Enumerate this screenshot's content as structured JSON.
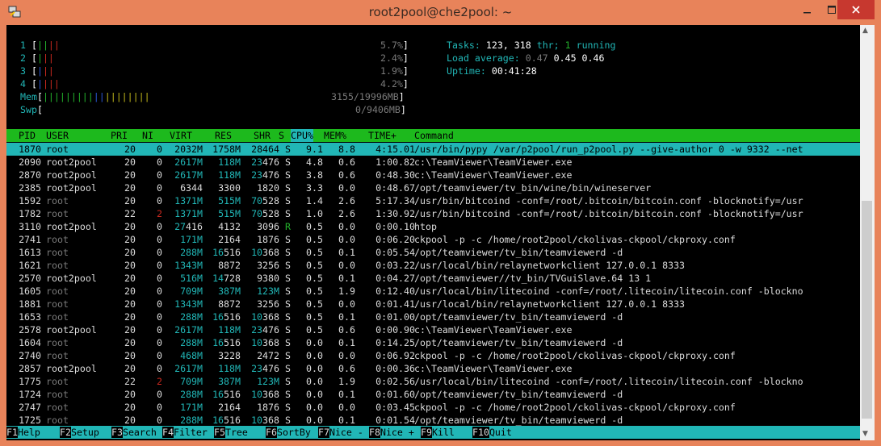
{
  "window": {
    "title": "root2pool@che2pool: ~"
  },
  "meters": {
    "cpus": [
      {
        "label": "1",
        "percent": "5.7%"
      },
      {
        "label": "2",
        "percent": "2.4%"
      },
      {
        "label": "3",
        "percent": "1.9%"
      },
      {
        "label": "4",
        "percent": "4.2%"
      }
    ],
    "mem": {
      "label": "Mem",
      "value": "3155/19996MB"
    },
    "swp": {
      "label": "Swp",
      "value": "0/9406MB"
    }
  },
  "summary": {
    "tasks_label": "Tasks:",
    "tasks": "123,",
    "thr": "318",
    "thr_label": "thr;",
    "running": "1",
    "running_label": "running",
    "load_label": "Load average:",
    "load1": "0.47",
    "load5": "0.45",
    "load15": "0.46",
    "uptime_label": "Uptime:",
    "uptime": "00:41:28"
  },
  "columns": [
    "PID",
    "USER",
    "PRI",
    "NI",
    "VIRT",
    "RES",
    "SHR",
    "S",
    "CPU%",
    "MEM%",
    "TIME+",
    "Command"
  ],
  "processes": [
    {
      "pid": "1870",
      "user": "root",
      "pri": "20",
      "ni": "0",
      "virt": "2032M",
      "res": "1758M",
      "shr": "28464",
      "s": "S",
      "cpu": "9.1",
      "mem": "8.8",
      "time": "4:15.01",
      "cmd": "/usr/bin/pypy /var/p2pool/run_p2pool.py --give-author 0 -w 9332 --net"
    },
    {
      "pid": "2090",
      "user": "root2pool",
      "pri": "20",
      "ni": "0",
      "virt": "2617M",
      "res": "118M",
      "shr": "23476",
      "s": "S",
      "cpu": "4.8",
      "mem": "0.6",
      "time": "1:00.82",
      "cmd": "c:\\TeamViewer\\TeamViewer.exe"
    },
    {
      "pid": "2870",
      "user": "root2pool",
      "pri": "20",
      "ni": "0",
      "virt": "2617M",
      "res": "118M",
      "shr": "23476",
      "s": "S",
      "cpu": "3.8",
      "mem": "0.6",
      "time": "0:48.30",
      "cmd": "c:\\TeamViewer\\TeamViewer.exe"
    },
    {
      "pid": "2385",
      "user": "root2pool",
      "pri": "20",
      "ni": "0",
      "virt": "6344",
      "res": "3300",
      "shr": "1820",
      "s": "S",
      "cpu": "3.3",
      "mem": "0.0",
      "time": "0:48.67",
      "cmd": "/opt/teamviewer/tv_bin/wine/bin/wineserver"
    },
    {
      "pid": "1592",
      "user": "root",
      "pri": "20",
      "ni": "0",
      "virt": "1371M",
      "res": "515M",
      "shr": "70528",
      "s": "S",
      "cpu": "1.4",
      "mem": "2.6",
      "time": "5:17.34",
      "cmd": "/usr/bin/bitcoind -conf=/root/.bitcoin/bitcoin.conf -blocknotify=/usr"
    },
    {
      "pid": "1782",
      "user": "root",
      "pri": "22",
      "ni": "2",
      "virt": "1371M",
      "res": "515M",
      "shr": "70528",
      "s": "S",
      "cpu": "1.0",
      "mem": "2.6",
      "time": "1:30.92",
      "cmd": "/usr/bin/bitcoind -conf=/root/.bitcoin/bitcoin.conf -blocknotify=/usr"
    },
    {
      "pid": "3110",
      "user": "root2pool",
      "pri": "20",
      "ni": "0",
      "virt": "27416",
      "res": "4132",
      "shr": "3096",
      "s": "R",
      "cpu": "0.5",
      "mem": "0.0",
      "time": "0:00.10",
      "cmd": "htop"
    },
    {
      "pid": "2741",
      "user": "root",
      "pri": "20",
      "ni": "0",
      "virt": "171M",
      "res": "2164",
      "shr": "1876",
      "s": "S",
      "cpu": "0.5",
      "mem": "0.0",
      "time": "0:06.20",
      "cmd": "ckpool -p -c /home/root2pool/ckolivas-ckpool/ckproxy.conf"
    },
    {
      "pid": "1613",
      "user": "root",
      "pri": "20",
      "ni": "0",
      "virt": "288M",
      "res": "16516",
      "shr": "10368",
      "s": "S",
      "cpu": "0.5",
      "mem": "0.1",
      "time": "0:05.54",
      "cmd": "/opt/teamviewer/tv_bin/teamviewerd -d"
    },
    {
      "pid": "1621",
      "user": "root",
      "pri": "20",
      "ni": "0",
      "virt": "1343M",
      "res": "8872",
      "shr": "3256",
      "s": "S",
      "cpu": "0.5",
      "mem": "0.0",
      "time": "0:03.22",
      "cmd": "/usr/local/bin/relaynetworkclient 127.0.0.1 8333"
    },
    {
      "pid": "2570",
      "user": "root2pool",
      "pri": "20",
      "ni": "0",
      "virt": "516M",
      "res": "14728",
      "shr": "9380",
      "s": "S",
      "cpu": "0.5",
      "mem": "0.1",
      "time": "0:04.27",
      "cmd": "/opt/teamviewer//tv_bin/TVGuiSlave.64 13 1"
    },
    {
      "pid": "1605",
      "user": "root",
      "pri": "20",
      "ni": "0",
      "virt": "709M",
      "res": "387M",
      "shr": "123M",
      "s": "S",
      "cpu": "0.5",
      "mem": "1.9",
      "time": "0:12.40",
      "cmd": "/usr/local/bin/litecoind -conf=/root/.litecoin/litecoin.conf -blockno"
    },
    {
      "pid": "1881",
      "user": "root",
      "pri": "20",
      "ni": "0",
      "virt": "1343M",
      "res": "8872",
      "shr": "3256",
      "s": "S",
      "cpu": "0.5",
      "mem": "0.0",
      "time": "0:01.41",
      "cmd": "/usr/local/bin/relaynetworkclient 127.0.0.1 8333"
    },
    {
      "pid": "1653",
      "user": "root",
      "pri": "20",
      "ni": "0",
      "virt": "288M",
      "res": "16516",
      "shr": "10368",
      "s": "S",
      "cpu": "0.5",
      "mem": "0.1",
      "time": "0:01.00",
      "cmd": "/opt/teamviewer/tv_bin/teamviewerd -d"
    },
    {
      "pid": "2578",
      "user": "root2pool",
      "pri": "20",
      "ni": "0",
      "virt": "2617M",
      "res": "118M",
      "shr": "23476",
      "s": "S",
      "cpu": "0.5",
      "mem": "0.6",
      "time": "0:00.90",
      "cmd": "c:\\TeamViewer\\TeamViewer.exe"
    },
    {
      "pid": "1604",
      "user": "root",
      "pri": "20",
      "ni": "0",
      "virt": "288M",
      "res": "16516",
      "shr": "10368",
      "s": "S",
      "cpu": "0.0",
      "mem": "0.1",
      "time": "0:14.25",
      "cmd": "/opt/teamviewer/tv_bin/teamviewerd -d"
    },
    {
      "pid": "2740",
      "user": "root",
      "pri": "20",
      "ni": "0",
      "virt": "468M",
      "res": "3228",
      "shr": "2472",
      "s": "S",
      "cpu": "0.0",
      "mem": "0.0",
      "time": "0:06.92",
      "cmd": "ckpool -p -c /home/root2pool/ckolivas-ckpool/ckproxy.conf"
    },
    {
      "pid": "2857",
      "user": "root2pool",
      "pri": "20",
      "ni": "0",
      "virt": "2617M",
      "res": "118M",
      "shr": "23476",
      "s": "S",
      "cpu": "0.0",
      "mem": "0.6",
      "time": "0:00.36",
      "cmd": "c:\\TeamViewer\\TeamViewer.exe"
    },
    {
      "pid": "1775",
      "user": "root",
      "pri": "22",
      "ni": "2",
      "virt": "709M",
      "res": "387M",
      "shr": "123M",
      "s": "S",
      "cpu": "0.0",
      "mem": "1.9",
      "time": "0:02.56",
      "cmd": "/usr/local/bin/litecoind -conf=/root/.litecoin/litecoin.conf -blockno"
    },
    {
      "pid": "1724",
      "user": "root",
      "pri": "20",
      "ni": "0",
      "virt": "288M",
      "res": "16516",
      "shr": "10368",
      "s": "S",
      "cpu": "0.0",
      "mem": "0.1",
      "time": "0:01.60",
      "cmd": "/opt/teamviewer/tv_bin/teamviewerd -d"
    },
    {
      "pid": "2747",
      "user": "root",
      "pri": "20",
      "ni": "0",
      "virt": "171M",
      "res": "2164",
      "shr": "1876",
      "s": "S",
      "cpu": "0.0",
      "mem": "0.0",
      "time": "0:03.45",
      "cmd": "ckpool -p -c /home/root2pool/ckolivas-ckpool/ckproxy.conf"
    },
    {
      "pid": "1725",
      "user": "root",
      "pri": "20",
      "ni": "0",
      "virt": "288M",
      "res": "16516",
      "shr": "10368",
      "s": "S",
      "cpu": "0.0",
      "mem": "0.1",
      "time": "0:01.54",
      "cmd": "/opt/teamviewer/tv_bin/teamviewerd -d"
    }
  ],
  "fkeys": [
    {
      "key": "F1",
      "label": "Help  "
    },
    {
      "key": "F2",
      "label": "Setup "
    },
    {
      "key": "F3",
      "label": "Search"
    },
    {
      "key": "F4",
      "label": "Filter"
    },
    {
      "key": "F5",
      "label": "Tree  "
    },
    {
      "key": "F6",
      "label": "SortBy"
    },
    {
      "key": "F7",
      "label": "Nice -"
    },
    {
      "key": "F8",
      "label": "Nice +"
    },
    {
      "key": "F9",
      "label": "Kill  "
    },
    {
      "key": "F10",
      "label": "Quit"
    }
  ],
  "colors": {
    "window_frame": "#e8835a",
    "cyan": "#21b6b6",
    "header_green": "#1db91d",
    "close": "#c7382f"
  },
  "icons": {
    "app": "putty-icon",
    "minimize": "minimize-icon",
    "maximize": "maximize-icon",
    "close": "close-icon"
  }
}
